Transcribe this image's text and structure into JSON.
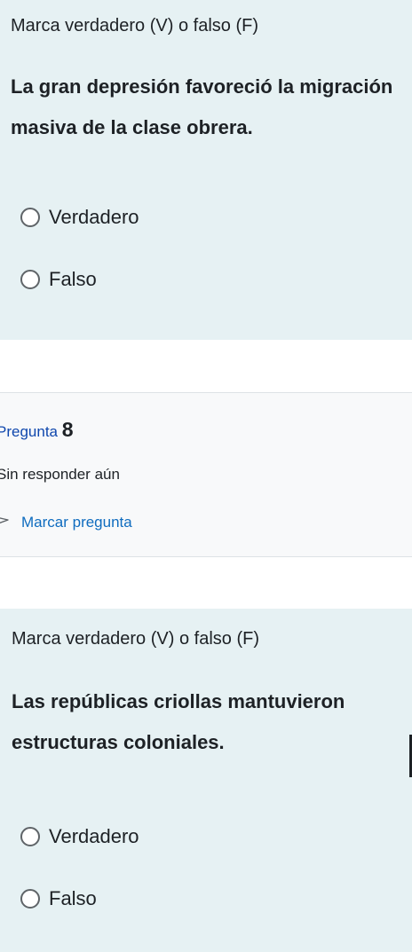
{
  "question7": {
    "instruction": "Marca verdadero (V) o falso (F)",
    "text": "La gran depresión favoreció la migración masiva de la clase obrera.",
    "options": [
      {
        "label": "Verdadero",
        "selected": false
      },
      {
        "label": "Falso",
        "selected": false
      }
    ]
  },
  "question8_info": {
    "label": "Pregunta",
    "number": "8",
    "state": "Sin responder aún",
    "flag_label": "Marcar pregunta"
  },
  "question8": {
    "instruction": "Marca verdadero (V) o falso (F)",
    "text": "Las repúblicas criollas mantuvieron estructuras coloniales.",
    "options": [
      {
        "label": "Verdadero",
        "selected": false
      },
      {
        "label": "Falso",
        "selected": false
      }
    ]
  },
  "colors": {
    "card_bg": "#e6f1f3",
    "info_bg": "#f8f9fa",
    "link": "#0f6cbf",
    "question_number_label": "#0f47ad"
  },
  "icons": {
    "radio": "radio-unchecked-icon",
    "flag": "flag-outline-icon"
  }
}
